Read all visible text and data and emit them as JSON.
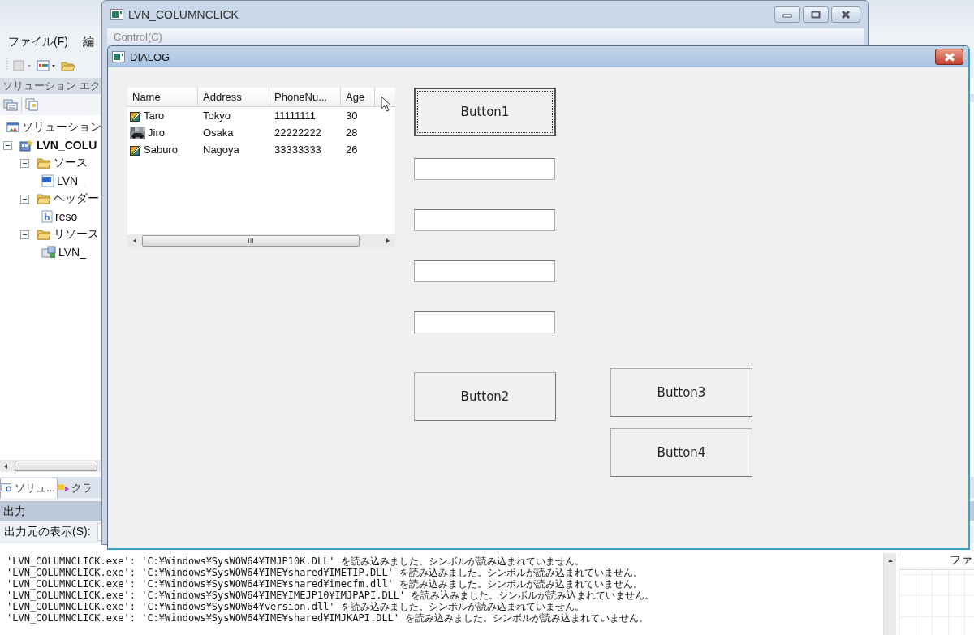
{
  "ide": {
    "menu": [
      "ファイル(F)",
      "編"
    ],
    "solution_explorer": {
      "title": "ソリューション エク",
      "tree": [
        {
          "label": "ソリューション",
          "kind": "solution",
          "children": [
            {
              "label": "LVN_COLU",
              "kind": "project",
              "expanded": true,
              "children": [
                {
                  "label": "ソース",
                  "kind": "folder",
                  "expanded": true,
                  "children": [
                    {
                      "label": "LVN_",
                      "kind": "cpp"
                    }
                  ]
                },
                {
                  "label": "ヘッダー",
                  "kind": "folder",
                  "expanded": true,
                  "children": [
                    {
                      "label": "reso",
                      "kind": "header"
                    }
                  ]
                },
                {
                  "label": "リソース",
                  "kind": "folder",
                  "expanded": true,
                  "children": [
                    {
                      "label": "LVN_",
                      "kind": "resource"
                    }
                  ]
                }
              ]
            }
          ]
        }
      ]
    },
    "pane_tabs": [
      {
        "label": "ソリュ...",
        "selected": true
      },
      {
        "label": "クラ",
        "selected": false
      }
    ],
    "output": {
      "title": "出力",
      "source_label": "出力元の表示(S):",
      "lines": [
        "'LVN_COLUMNCLICK.exe': 'C:¥Windows¥SysWOW64¥IMJP10K.DLL' を読み込みました。シンボルが読み込まれていません。",
        "'LVN_COLUMNCLICK.exe': 'C:¥Windows¥SysWOW64¥IME¥shared¥IMETIP.DLL' を読み込みました。シンボルが読み込まれていません。",
        "'LVN_COLUMNCLICK.exe': 'C:¥Windows¥SysWOW64¥IME¥shared¥imecfm.dll' を読み込みました。シンボルが読み込まれていません。",
        "'LVN_COLUMNCLICK.exe': 'C:¥Windows¥SysWOW64¥IME¥IMEJP10¥IMJPAPI.DLL' を読み込みました。シンボルが読み込まれていません。",
        "'LVN_COLUMNCLICK.exe': 'C:¥Windows¥SysWOW64¥version.dll' を読み込みました。シンボルが読み込まれていません。",
        "'LVN_COLUMNCLICK.exe': 'C:¥Windows¥SysWOW64¥IME¥shared¥IMJKAPI.DLL' を読み込みました。シンボルが読み込まれていません。"
      ]
    },
    "right_panel": {
      "header": "ファ"
    }
  },
  "main_window": {
    "title": "LVN_COLUMNCLICK",
    "menu": [
      {
        "label": "Control(C)",
        "disabled": true
      }
    ]
  },
  "dialog": {
    "title": "DIALOG",
    "list": {
      "columns": [
        "Name",
        "Address",
        "PhoneNu...",
        "Age"
      ],
      "rows": [
        {
          "kind": "pencil",
          "cells": [
            "Taro",
            "Tokyo",
            "11111111",
            "30"
          ]
        },
        {
          "cells": [
            "Jiro",
            "Osaka",
            "22222222",
            "28"
          ]
        },
        {
          "kind": "pencil",
          "cells": [
            "Saburo",
            "Nagoya",
            "33333333",
            "26"
          ]
        }
      ]
    },
    "buttons": [
      {
        "label": "Button1",
        "default": true
      },
      {
        "label": "Button2",
        "default": false
      },
      {
        "label": "Button3",
        "default": false
      },
      {
        "label": "Button4",
        "default": false
      }
    ]
  }
}
